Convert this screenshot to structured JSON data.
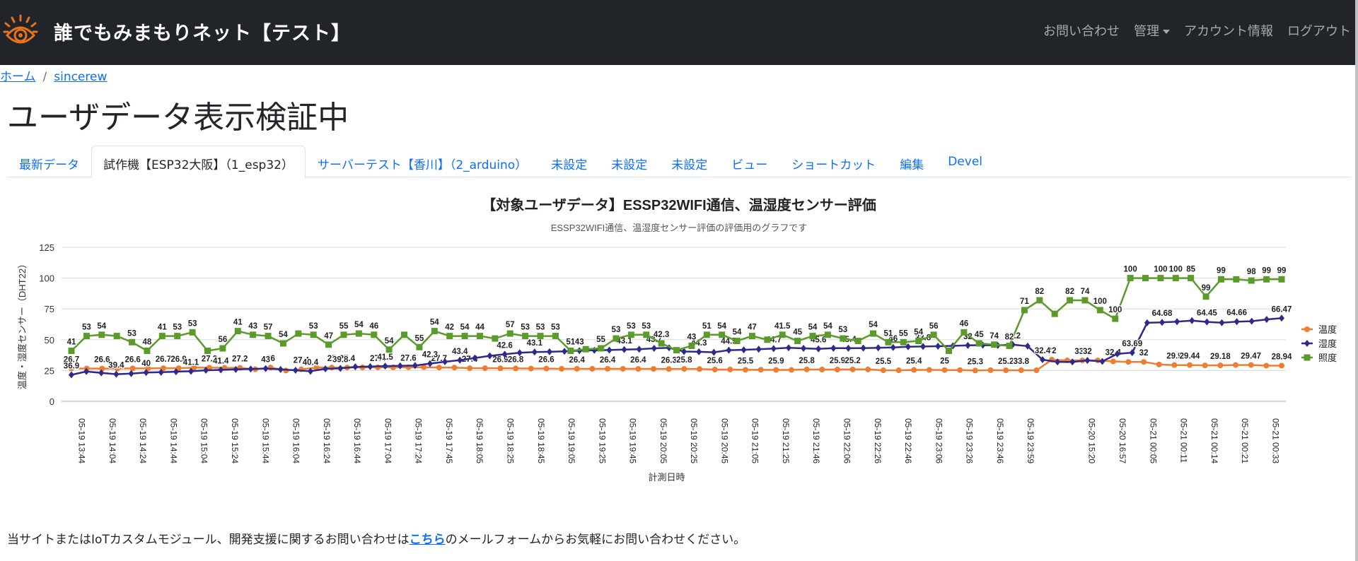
{
  "navbar": {
    "brand": "誰でもみまもりネット【テスト】",
    "links": [
      "お問い合わせ",
      "管理",
      "アカウント情報",
      "ログアウト"
    ]
  },
  "breadcrumb": {
    "home": "ホーム",
    "separator": "/",
    "current": "sincerew"
  },
  "page": {
    "title": "ユーザデータ表示検証中"
  },
  "tabs": [
    "最新データ",
    "試作機【ESP32大阪】（1_esp32）",
    "サーバーテスト【香川】（2_arduino）",
    "未設定",
    "未設定",
    "未設定",
    "ビュー",
    "ショートカット",
    "編集",
    "Devel"
  ],
  "footer": {
    "before": "当サイトまたはIoTカスタムモジュール、開発支援に関するお問い合わせは",
    "link": "こちら",
    "after": "のメールフォームからお気軽にお問い合わせください。"
  },
  "chart_data": {
    "type": "line",
    "title": "【対象ユーザデータ】ESSP32WIFI通信、温湿度センサー評価",
    "subtitle": "ESSP32WIFI通信、温湿度センサー評価の評価用のグラフです",
    "ylabel": "温度・湿度センサー（DHT22）",
    "xlabel": "計測日時",
    "ylim": [
      0,
      125
    ],
    "yticks": [
      0,
      25,
      50,
      75,
      100,
      125
    ],
    "grid": true,
    "legend_position": "right",
    "x": [
      "05-19 13:44",
      "05-19 14:04",
      "05-19 14:24",
      "05-19 14:44",
      "05-19 15:04",
      "05-19 15:24",
      "05-19 15:44",
      "05-19 16:04",
      "05-19 16:24",
      "05-19 16:44",
      "05-19 17:04",
      "05-19 17:24",
      "05-19 17:45",
      "05-19 18:05",
      "05-19 18:25",
      "05-19 18:45",
      "05-19 19:05",
      "05-19 19:25",
      "05-19 19:45",
      "05-19 20:05",
      "05-19 20:25",
      "05-19 20:45",
      "05-19 21:05",
      "05-19 21:25",
      "05-19 21:46",
      "05-19 22:06",
      "05-19 22:26",
      "05-19 22:46",
      "05-19 23:06",
      "05-19 23:26",
      "05-19 23:46",
      "05-19 23:59",
      "",
      "05-20 15:20",
      "05-20 16:57",
      "05-21 00:05",
      "05-21 00:11",
      "05-21 00:14",
      "05-21 00:21",
      "05-21 00:33"
    ],
    "series": [
      {
        "name": "温度",
        "color": "#ed7d31",
        "marker": "circle",
        "values": [
          26.7,
          26.6,
          26.6,
          26.6,
          26.7,
          26.7,
          26.9,
          26.9,
          27.3,
          27.3,
          27.2,
          27.2,
          26,
          27.4,
          25,
          26,
          27.4,
          27.4,
          27.4,
          27.5,
          27.6,
          27.6,
          27.7,
          27.7,
          27.4,
          27.4,
          26.9,
          26.9,
          26.8,
          26.7,
          26.6,
          26.6,
          26.4,
          26.4,
          26.4,
          26.4,
          26.4,
          26.3,
          26.3,
          26.2,
          26.3,
          26.2,
          25.8,
          25.8,
          25.6,
          25.6,
          25.5,
          25.5,
          25.9,
          25.8,
          25.8,
          25.9,
          25.9,
          25.2,
          25.2,
          25.5,
          25.5,
          25.4,
          25.4,
          25,
          25.3,
          25.2,
          25.2,
          25.2,
          33.8,
          33.2,
          33.2,
          33.2,
          32.4,
          32,
          32,
          29.9,
          29.44,
          29.44,
          29.18,
          29.18,
          29.47,
          29.47,
          28.94,
          28.94
        ],
        "point_labels": [
          "26.7",
          "26.6",
          "26.6",
          "26.7",
          "26.9",
          "27.3",
          "27.2",
          "26",
          "27.4",
          "25",
          "27.4",
          "27.4",
          "27.6",
          "27.7",
          "27.4",
          "26.9",
          "26.8",
          "26.6",
          "26.4",
          "26.4",
          "26.4",
          "26.3",
          "25.8",
          "25.6",
          "25.5",
          "25.9",
          "25.8",
          "25.9",
          "25.2",
          "25.5",
          "25.4",
          "25",
          "25.3",
          "25.2",
          "33.8",
          "32",
          "33.2",
          "32.4",
          "32",
          "29.9",
          "29.44",
          "29.18",
          "29.47",
          "28.94"
        ]
      },
      {
        "name": "湿度",
        "color": "#2e2a8c",
        "marker": "diamond",
        "values": [
          21.5,
          24.2,
          23.1,
          22,
          22.5,
          23.4,
          23.6,
          24,
          24.4,
          25.2,
          25.5,
          25.9,
          26.2,
          26.6,
          25.9,
          25.2,
          24.4,
          26.4,
          26.7,
          28,
          28.2,
          28.6,
          28.8,
          29,
          30.6,
          32.1,
          33.4,
          35.1,
          36.9,
          38.2,
          39.4,
          40,
          40.2,
          40.6,
          41.1,
          41.4,
          41.6,
          42,
          42.3,
          43,
          43.4,
          40.4,
          40.2,
          39.8,
          41.5,
          41.8,
          42.3,
          42.8,
          43.4,
          43,
          42.6,
          43.1,
          43.1,
          43.2,
          43.4,
          43.7,
          44.3,
          44.5,
          44.7,
          45,
          45.4,
          45.6,
          45.4,
          46,
          44.8,
          33.8,
          32,
          32,
          33.2,
          32.4,
          38.5,
          39.5,
          63.69,
          64.1,
          64.68,
          65.5,
          64.45,
          63.8,
          64.66,
          65,
          66.47,
          67.5
        ],
        "point_labels": [
          "36.9",
          "39.4",
          "40",
          "41.1",
          "41.4",
          "43",
          "40.4",
          "39.8",
          "41.5",
          "42.3",
          "43.4",
          "42.6",
          "43.1",
          "43",
          "43.1",
          "43.7",
          "44.3",
          "44.5",
          "44.7",
          "45.6",
          "45.4",
          "46",
          "33.8",
          "32",
          "33.2",
          "32.4",
          "32",
          "63.69",
          "64.68",
          "64.45",
          "64.66",
          "66.47"
        ]
      },
      {
        "name": "照度",
        "color": "#5b9b2b",
        "marker": "square",
        "values": [
          41,
          53,
          54,
          53,
          48,
          41,
          53,
          53,
          56,
          41,
          43,
          57,
          54,
          53,
          47,
          55,
          54,
          46,
          54,
          55,
          54,
          42,
          54,
          44,
          57,
          53,
          53,
          53,
          51,
          55,
          53,
          53,
          53,
          41,
          42.3,
          43,
          51,
          54,
          54,
          47,
          41.5,
          45,
          54,
          54,
          49,
          53,
          50,
          54,
          49,
          53,
          54,
          51,
          49,
          55,
          48,
          48,
          49,
          54,
          41,
          56,
          47,
          46,
          45,
          74,
          82,
          71,
          82,
          82,
          74,
          67,
          100,
          100,
          100,
          100,
          100,
          85,
          99,
          99,
          98,
          99,
          99
        ],
        "point_labels": [
          "41",
          "53",
          "54",
          "53",
          "48",
          "41",
          "53",
          "53",
          "56",
          "41",
          "43",
          "57",
          "54",
          "53",
          "47",
          "55",
          "54",
          "46",
          "54",
          "55",
          "54",
          "42",
          "54",
          "44",
          "57",
          "53",
          "53",
          "53",
          "51",
          "55",
          "53",
          "53",
          "53",
          "42.3",
          "43",
          "51",
          "54",
          "54",
          "47",
          "41.5",
          "45",
          "54",
          "54",
          "53",
          "54",
          "51",
          "55",
          "54",
          "56",
          "46",
          "45",
          "74",
          "82",
          "71",
          "82",
          "82",
          "74",
          "100",
          "100",
          "100",
          "100",
          "100",
          "85",
          "99",
          "99",
          "98",
          "99",
          "99"
        ]
      }
    ]
  }
}
